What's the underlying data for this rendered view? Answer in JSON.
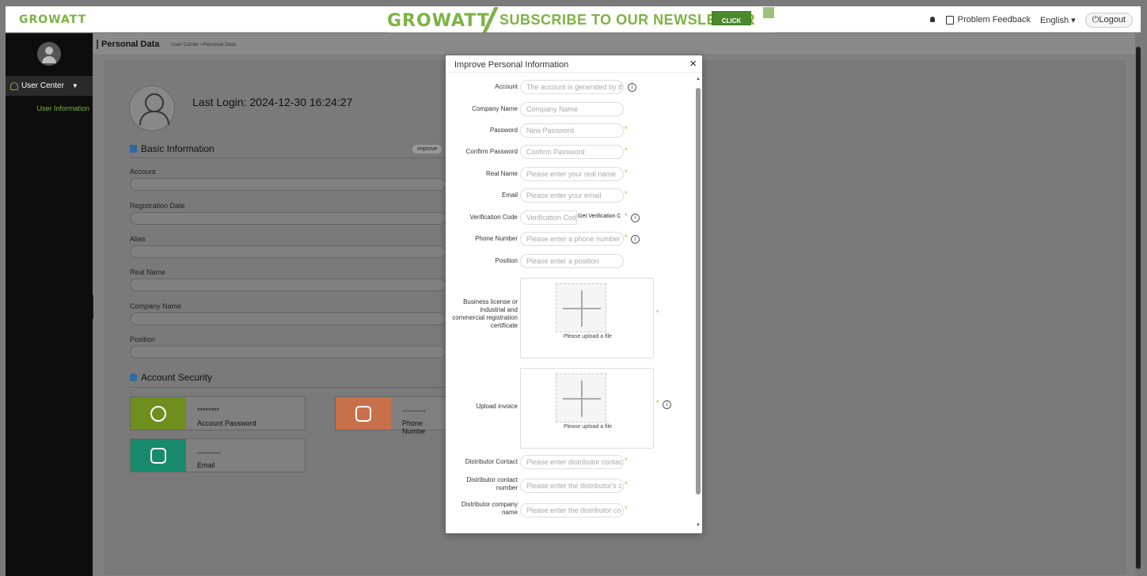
{
  "header": {
    "logo": "GROWATT",
    "banner": {
      "logo": "GROWATT",
      "headline": "SUBSCRIBE TO OUR NEWSLETTER",
      "cta": "CLICK HERE"
    },
    "feedback_label": "Problem Feedback",
    "language": "English ▾",
    "logout_label": "Logout"
  },
  "sidebar": {
    "menu_label": "User Center",
    "sub_item": "User Information"
  },
  "page": {
    "title": "Personal Data",
    "breadcrumb": "User Center >Personal Data",
    "last_login": "Last Login: 2024-12-30 16:24:27",
    "basic_info_title": "Basic Information",
    "improve_label": "Improve",
    "fields": [
      "Account",
      "Registration Date",
      "Alias",
      "Real Name",
      "Company Name",
      "Position"
    ],
    "security_title": "Account Security",
    "security_cards": [
      {
        "dots": "********",
        "title": "Account Password",
        "color": "#6e8f1e"
      },
      {
        "dots": "----------",
        "title": "Phone Numbe",
        "color": "#c8704a"
      },
      {
        "dots": "----------",
        "title": "Email",
        "color": "#178a6b"
      }
    ]
  },
  "modal": {
    "title": "Improve Personal Information",
    "close": "×",
    "fields": {
      "account": {
        "label": "Account",
        "placeholder": "The account is generated by th"
      },
      "company": {
        "label": "Company Name",
        "placeholder": "Company Name"
      },
      "password": {
        "label": "Password",
        "placeholder": "New Password"
      },
      "confirm": {
        "label": "Confirm Password",
        "placeholder": "Confirm Password"
      },
      "real_name": {
        "label": "Real Name",
        "placeholder": "Please enter your real name"
      },
      "email": {
        "label": "Email",
        "placeholder": "Please enter your email"
      },
      "verify": {
        "label": "Verification Code",
        "placeholder": "Verification Cod",
        "button": "Get Verification C"
      },
      "phone": {
        "label": "Phone Number",
        "placeholder": "Please enter a phone number"
      },
      "position": {
        "label": "Position",
        "placeholder": "Please enter a position"
      },
      "license": {
        "label": "Business license or industrial and commercial registration certificate",
        "upload_text": "Please upload a file"
      },
      "invoice": {
        "label": "Upload invoice",
        "upload_text": "Please upload a file"
      },
      "dist_contact": {
        "label": "Distributor Contact",
        "placeholder": "Please enter distributor contac"
      },
      "dist_number": {
        "label": "Distributor contact number",
        "placeholder": "Please enter the distributor's c"
      },
      "dist_company": {
        "label": "Distributor company name",
        "placeholder": "Please enter the distributor co"
      }
    },
    "required_mark": "*",
    "info_mark": "i"
  }
}
